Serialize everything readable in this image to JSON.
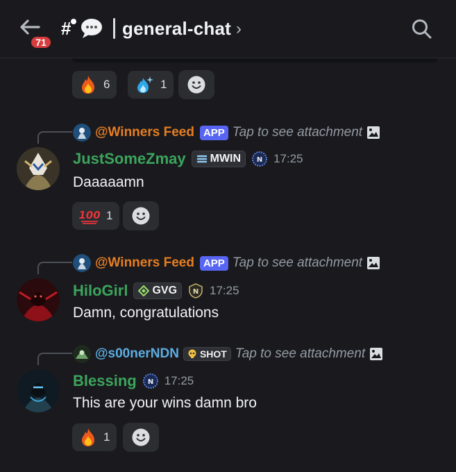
{
  "header": {
    "unread_badge": "71",
    "hash": "#",
    "channel_name": "general-chat",
    "chevron": "›"
  },
  "top_reactions": [
    {
      "emoji": "fire",
      "count": "6"
    },
    {
      "emoji": "blue-flame-sparkle",
      "count": "1"
    }
  ],
  "messages": [
    {
      "reply": {
        "name": "@Winners Feed",
        "tag": "APP",
        "text": "Tap to see attachment",
        "color": "#e67e22"
      },
      "author": "JustSomeZmay",
      "clan_tag": "MWIN",
      "time": "17:25",
      "text": "Daaaaamn",
      "reactions": [
        {
          "emoji": "100",
          "count": "1"
        }
      ]
    },
    {
      "reply": {
        "name": "@Winners Feed",
        "tag": "APP",
        "text": "Tap to see attachment",
        "color": "#e67e22"
      },
      "author": "HiloGirl",
      "clan_tag": "GVG",
      "time": "17:25",
      "text": "Damn, congratulations",
      "reactions": []
    },
    {
      "reply": {
        "name": "@s00nerNDN",
        "tag": "SHOT",
        "text": "Tap to see attachment",
        "color": "#5dade2"
      },
      "author": "Blessing",
      "clan_tag": "",
      "time": "17:25",
      "text": "This are your wins damn bro",
      "reactions": [
        {
          "emoji": "fire",
          "count": "1"
        }
      ]
    }
  ],
  "colors": {
    "background": "#1a1a1e",
    "username_green": "#3ba55c",
    "app_tag": "#5865f2",
    "badge_red": "#d83c3e"
  }
}
